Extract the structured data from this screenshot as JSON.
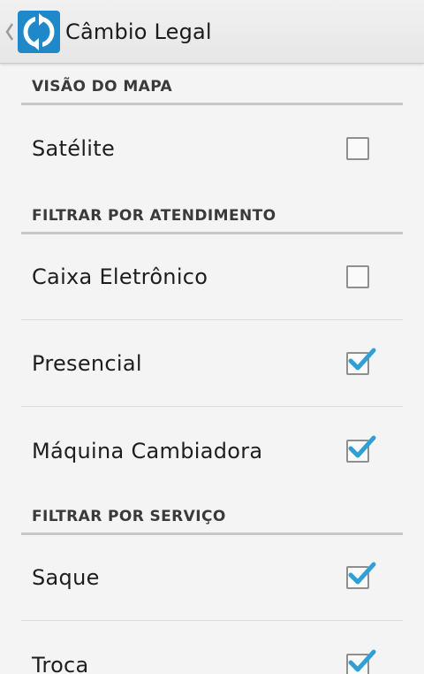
{
  "action_bar": {
    "title": "Câmbio Legal"
  },
  "sections": [
    {
      "header": "VISÃO DO MAPA",
      "items": [
        {
          "label": "Satélite",
          "checked": false
        }
      ]
    },
    {
      "header": "FILTRAR POR ATENDIMENTO",
      "items": [
        {
          "label": "Caixa Eletrônico",
          "checked": false
        },
        {
          "label": "Presencial",
          "checked": true
        },
        {
          "label": "Máquina Cambiadora",
          "checked": true
        }
      ]
    },
    {
      "header": "FILTRAR POR SERVIÇO",
      "items": [
        {
          "label": "Saque",
          "checked": true
        },
        {
          "label": "Troca",
          "checked": true
        }
      ]
    }
  ],
  "colors": {
    "check_accent": "#2f9fd6",
    "icon_background": "#1e88c9"
  }
}
